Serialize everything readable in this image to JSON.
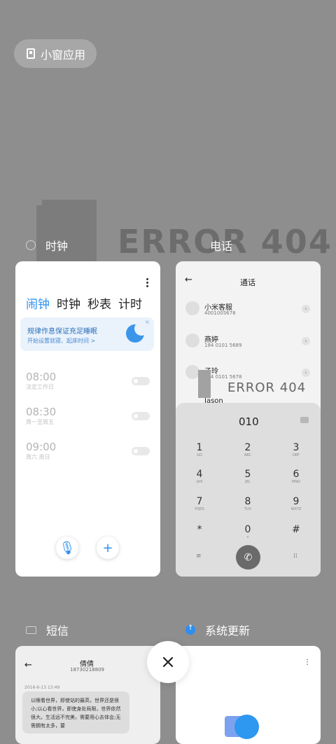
{
  "top": {
    "small_window_label": "小窗应用"
  },
  "error": {
    "bg_text": "ERROR 404",
    "overlay_text": "ERROR 404"
  },
  "clock": {
    "title": "时钟",
    "tabs": [
      "闹钟",
      "时钟",
      "秒表",
      "计时"
    ],
    "sleep_banner": {
      "title": "规律作息保证充足睡眠",
      "subtitle": "开始设置就寝、起床时间 >"
    },
    "alarms": [
      {
        "time": "08:00",
        "days": "法定工作日"
      },
      {
        "time": "08:30",
        "days": "周一至周五"
      },
      {
        "time": "09:00",
        "days": "周六 周日"
      }
    ]
  },
  "phone": {
    "title": "电话",
    "header": "通话",
    "contacts": [
      {
        "name": "小米客服",
        "number": "4001005678"
      },
      {
        "name": "燕婷",
        "number": "184 0101 5689"
      },
      {
        "name": "子玲",
        "number": "184 0101 5678"
      },
      {
        "name": "Jason",
        "number": ""
      }
    ],
    "dial_input": "010",
    "keys": [
      {
        "digit": "1",
        "sub": "GO"
      },
      {
        "digit": "2",
        "sub": "ABC"
      },
      {
        "digit": "3",
        "sub": "DEF"
      },
      {
        "digit": "4",
        "sub": "GHI"
      },
      {
        "digit": "5",
        "sub": "JKL"
      },
      {
        "digit": "6",
        "sub": "MNO"
      },
      {
        "digit": "7",
        "sub": "PQRS"
      },
      {
        "digit": "8",
        "sub": "TUV"
      },
      {
        "digit": "9",
        "sub": "WXYZ"
      },
      {
        "digit": "*",
        "sub": ""
      },
      {
        "digit": "0",
        "sub": "+"
      },
      {
        "digit": "#",
        "sub": ""
      }
    ]
  },
  "messages": {
    "title": "短信",
    "contact": "倩倩",
    "number": "18730218809",
    "date": "2016-6-13 13:49",
    "bubble": "以眼看世界，即使站的最高，世界还是很小;以心看世界，即使身处局限，世界依然很大。生活远不完美，需要用心去体会;无需拥有太多，要"
  },
  "update": {
    "title": "系统更新"
  },
  "colors": {
    "accent": "#2d8ff0",
    "background": "#8e8e8e"
  }
}
